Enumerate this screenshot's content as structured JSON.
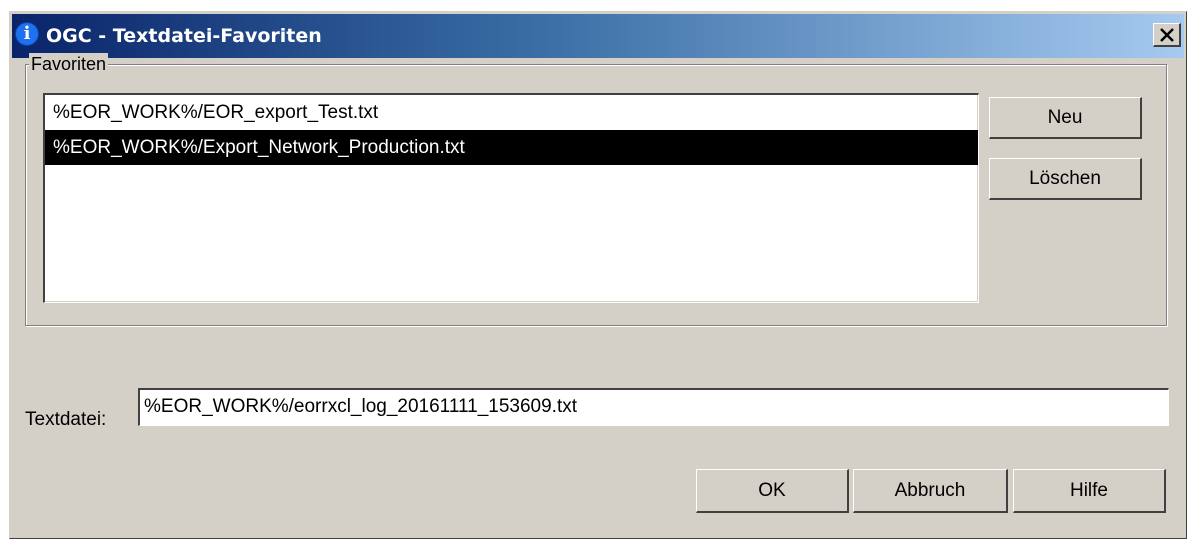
{
  "window": {
    "title": "OGC - Textdatei-Favoriten",
    "title_icon": "info-icon",
    "close_icon": "close-icon",
    "titlebar_colors": [
      "#0a246a",
      "#a6caf0"
    ]
  },
  "favorites": {
    "group_label": "Favoriten",
    "items": [
      {
        "label": "%EOR_WORK%/EOR_export_Test.txt",
        "selected": false
      },
      {
        "label": "%EOR_WORK%/Export_Network_Production.txt",
        "selected": true
      }
    ],
    "new_button": "Neu",
    "delete_button": "Löschen"
  },
  "textfile": {
    "label": "Textdatei:",
    "value": "%EOR_WORK%/eorrxcl_log_20161111_153609.txt"
  },
  "footer": {
    "ok_button": "OK",
    "cancel_button": "Abbruch",
    "help_button": "Hilfe"
  }
}
